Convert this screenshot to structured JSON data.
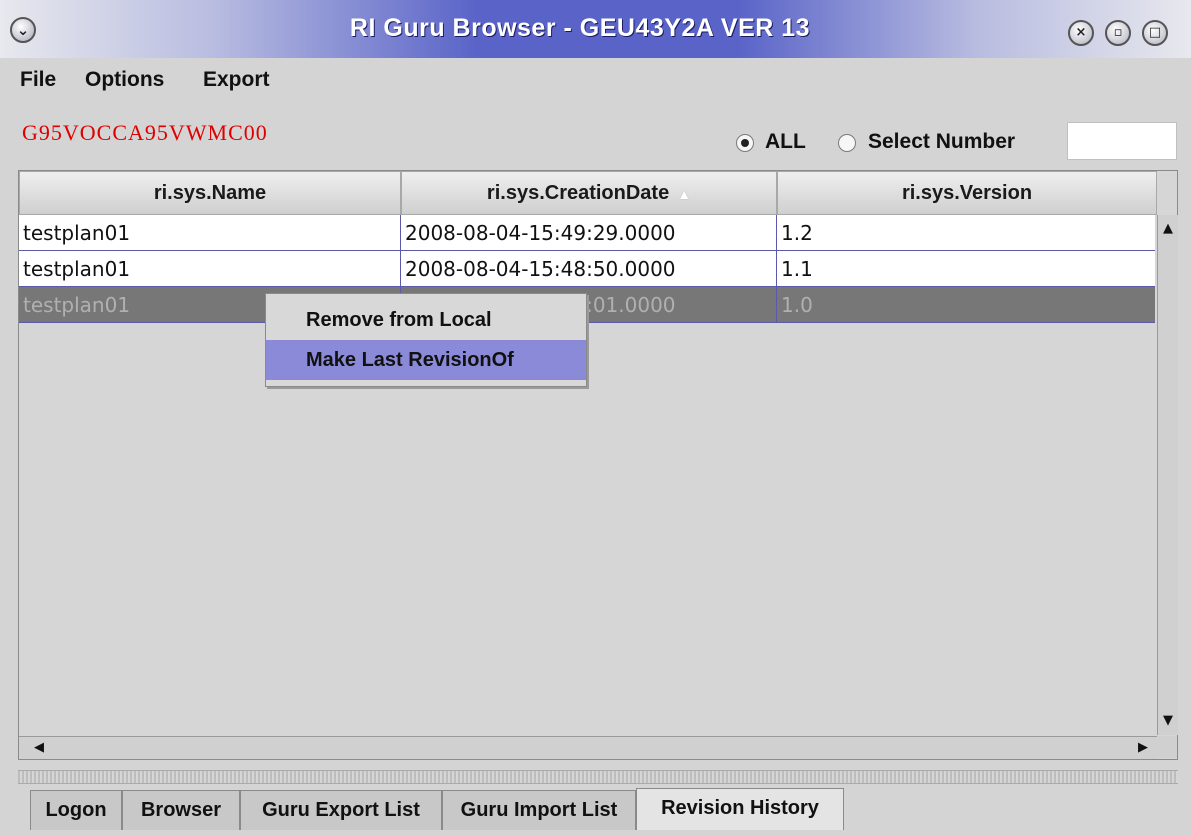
{
  "window": {
    "title": "RI Guru Browser - GEU43Y2A  VER 13"
  },
  "menu": {
    "file": "File",
    "options": "Options",
    "export": "Export"
  },
  "toolbar": {
    "plan_id": "G95VOCCA95VWMC00",
    "radio_all": "ALL",
    "radio_select": "Select Number",
    "number_value": ""
  },
  "table": {
    "columns": [
      "ri.sys.Name",
      "ri.sys.CreationDate",
      "ri.sys.Version"
    ],
    "sorted_column": "ri.sys.CreationDate",
    "rows": [
      [
        "testplan01",
        "2008-08-04-15:49:29.0000",
        "1.2"
      ],
      [
        "testplan01",
        "2008-08-04-15:48:50.0000",
        "1.1"
      ],
      [
        "testplan01",
        "2008-08-04-15:45:01.0000",
        "1.0"
      ]
    ],
    "selected_row": 2
  },
  "context_menu": {
    "items": [
      "Remove from Local",
      "Make Last RevisionOf"
    ],
    "highlighted": 1
  },
  "tabs": [
    "Logon",
    "Browser",
    "Guru Export List",
    "Guru Import List",
    "Revision History"
  ],
  "active_tab": "Revision History",
  "icons": {
    "window_menu": "chevron-down-icon",
    "close": "close-icon",
    "minimize": "minimize-icon",
    "maximize": "maximize-icon"
  }
}
